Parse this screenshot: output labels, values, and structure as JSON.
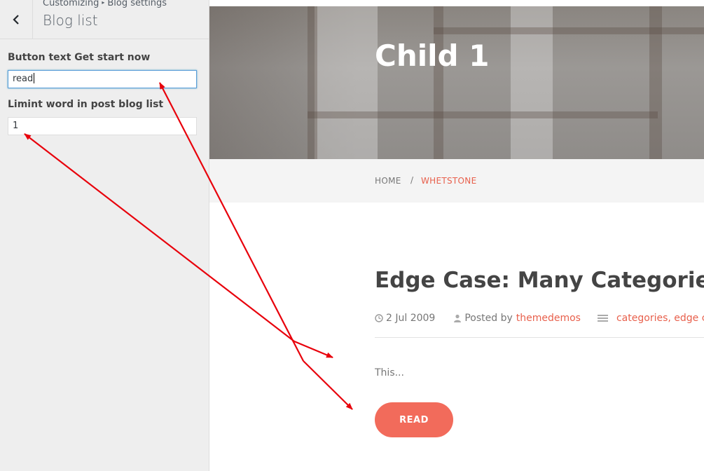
{
  "sidebar": {
    "breadcrumb_parent": "Customizing",
    "breadcrumb_child": "Blog settings",
    "section_title": "Blog list",
    "controls": [
      {
        "label": "Button text Get start now",
        "value": "read"
      },
      {
        "label": "Limint word in post blog list",
        "value": "1"
      }
    ]
  },
  "preview": {
    "hero_title": "Child 1",
    "breadcrumb": {
      "home": "HOME",
      "separator": "/",
      "current": "WHETSTONE"
    },
    "post": {
      "title": "Edge Case: Many Categories",
      "date": "2 Jul 2009",
      "posted_by_prefix": "Posted by",
      "author": "themedemos",
      "categories": "categories, edge ca",
      "excerpt": "This...",
      "button_label": "READ"
    }
  },
  "colors": {
    "accent": "#f26b5b",
    "link": "#e8604c",
    "annotation": "#e8000b"
  },
  "icons": [
    "back-chevron-icon",
    "clock-icon",
    "user-icon",
    "category-icon"
  ]
}
